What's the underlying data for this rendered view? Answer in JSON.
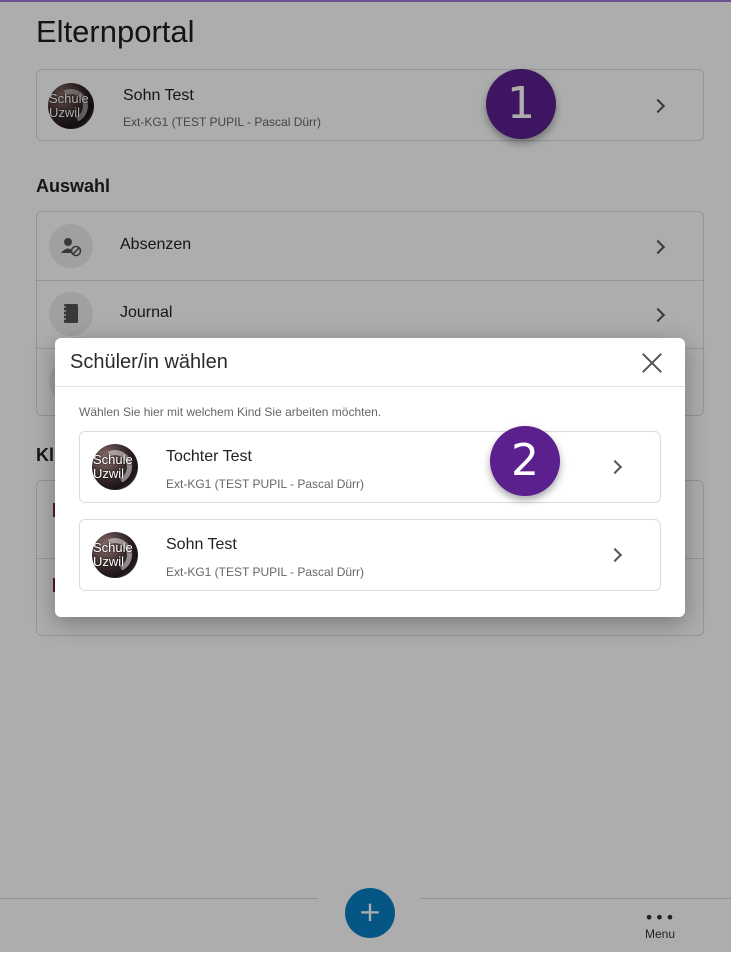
{
  "page": {
    "title": "Elternportal"
  },
  "current_student": {
    "name": "Sohn Test",
    "class_info": "Ext-KG1 (TEST PUPIL - Pascal Dürr)",
    "avatar_text": "Schule Uzwil"
  },
  "badges": {
    "first": "1",
    "second": "2",
    "color": "#5b1f8e"
  },
  "section_auswahl": {
    "title": "Auswahl",
    "items": [
      {
        "label": "Absenzen",
        "icon": "person-block-icon"
      },
      {
        "label": "Journal",
        "icon": "notebook-icon"
      },
      {
        "label": "",
        "icon": "circle-icon"
      }
    ]
  },
  "section_second": {
    "title": "Kl"
  },
  "modal": {
    "title": "Schüler/in wählen",
    "hint": "Wählen Sie hier mit welchem Kind Sie arbeiten möchten.",
    "choices": [
      {
        "name": "Tochter Test",
        "class_info": "Ext-KG1 (TEST PUPIL - Pascal Dürr)",
        "avatar_text": "Schule Uzwil"
      },
      {
        "name": "Sohn Test",
        "class_info": "Ext-KG1 (TEST PUPIL - Pascal Dürr)",
        "avatar_text": "Schule Uzwil"
      }
    ]
  },
  "bottom_nav": {
    "fab_label": "+",
    "menu_dots": "•••",
    "menu_label": "Menu",
    "fab_color": "#0a7fc4"
  }
}
